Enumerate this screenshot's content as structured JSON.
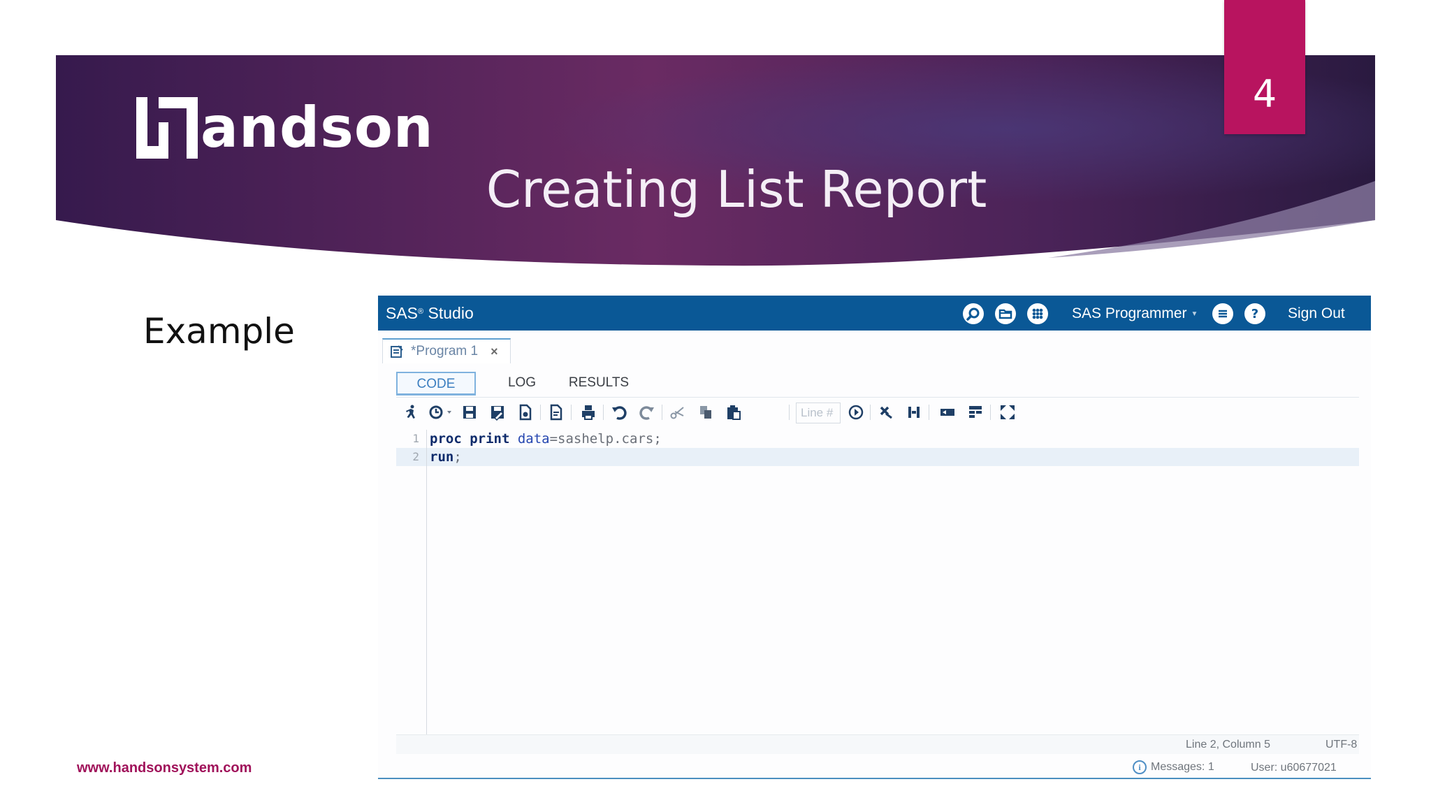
{
  "slide": {
    "logo_text": "andson",
    "title": "Creating List Report",
    "page_number": "4",
    "example_label": "Example",
    "footer_url": "www.handsonsystem.com",
    "colors": {
      "header_dark": "#341a4a",
      "header_mid": "#6b2a62",
      "accent": "#b8145f"
    }
  },
  "sas": {
    "brand": "SAS",
    "brand_sup": "®",
    "brand_suffix": " Studio",
    "role": "SAS Programmer",
    "sign_out": "Sign Out",
    "top_icons": [
      "search-icon",
      "folder-icon",
      "apps-grid-icon",
      "menu-icon",
      "help-icon"
    ],
    "help_glyph": "?",
    "program_tab": {
      "label": "*Program 1",
      "close": "×"
    },
    "subtabs": [
      "CODE",
      "LOG",
      "RESULTS"
    ],
    "active_subtab": "CODE",
    "line_placeholder": "Line #",
    "code": {
      "line_numbers": [
        "1",
        "2"
      ],
      "line1": {
        "kw1": "proc",
        "kw2": " print",
        "opt": " data",
        "rest": "=sashelp.cars;"
      },
      "line2": {
        "kw": "run",
        "rest": ";"
      }
    },
    "status": {
      "position": "Line 2, Column 5",
      "encoding": "UTF-8"
    },
    "messages": {
      "label": "Messages: 1",
      "user": "User: u60677021"
    }
  }
}
